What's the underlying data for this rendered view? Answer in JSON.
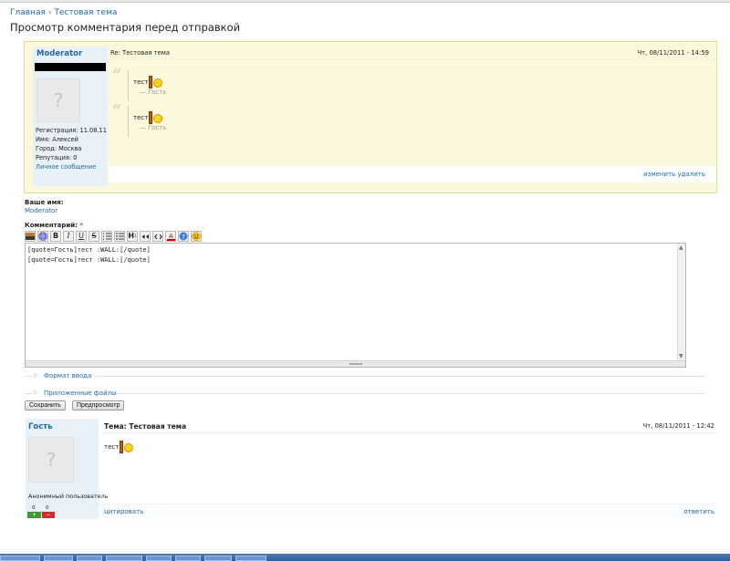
{
  "breadcrumb": {
    "home": "Главная",
    "separator": "›",
    "topic": "Тестовая тема"
  },
  "page_title": "Просмотр комментария перед отправкой",
  "preview": {
    "author": "Moderator",
    "avatar_placeholder": "?",
    "info": {
      "registration": "Регистрация: 11.08.11",
      "name": "Имя: Алексей",
      "city": "Город: Москва",
      "reputation": "Репутация: 0",
      "pm_link": "Личное сообщение"
    },
    "subject": "Re: Тестовая тема",
    "date": "Чт, 08/11/2011 - 14:59",
    "quotes": [
      {
        "mark": "“",
        "text": "тест",
        "author": "— Гость"
      },
      {
        "mark": "“",
        "text": "тест",
        "author": "— Гость"
      }
    ],
    "edit_link": "изменить",
    "delete_link": "удалить"
  },
  "form": {
    "name_label": "Ваше имя:",
    "name_value": "Moderator",
    "comment_label": "Комментарий:",
    "required_mark": "*",
    "toolbar": [
      "image",
      "globe",
      "B",
      "I",
      "U",
      "S",
      "ol",
      "ul",
      "H",
      "quote",
      "code",
      "color",
      "help",
      "smiley"
    ],
    "comment_text": "[quote=Гость]тест :WALL:[/quote]\n[quote=Гость]тест :WALL:[/quote]",
    "input_format": "Формат ввода",
    "attachments": "Приложенные файлы",
    "save_button": "Сохранить",
    "preview_button": "Предпросмотр"
  },
  "comment": {
    "author": "Гость",
    "avatar_placeholder": "?",
    "role": "Анонимный пользователь",
    "votes_up": "0",
    "votes_down": "0",
    "vote_up_symbol": "+",
    "vote_down_symbol": "−",
    "title": "Тема: Тестовая тема",
    "date": "Чт, 08/11/2011 - 12:42",
    "body": "тест",
    "quote_link": "цитировать",
    "reply_link": "ответить"
  }
}
